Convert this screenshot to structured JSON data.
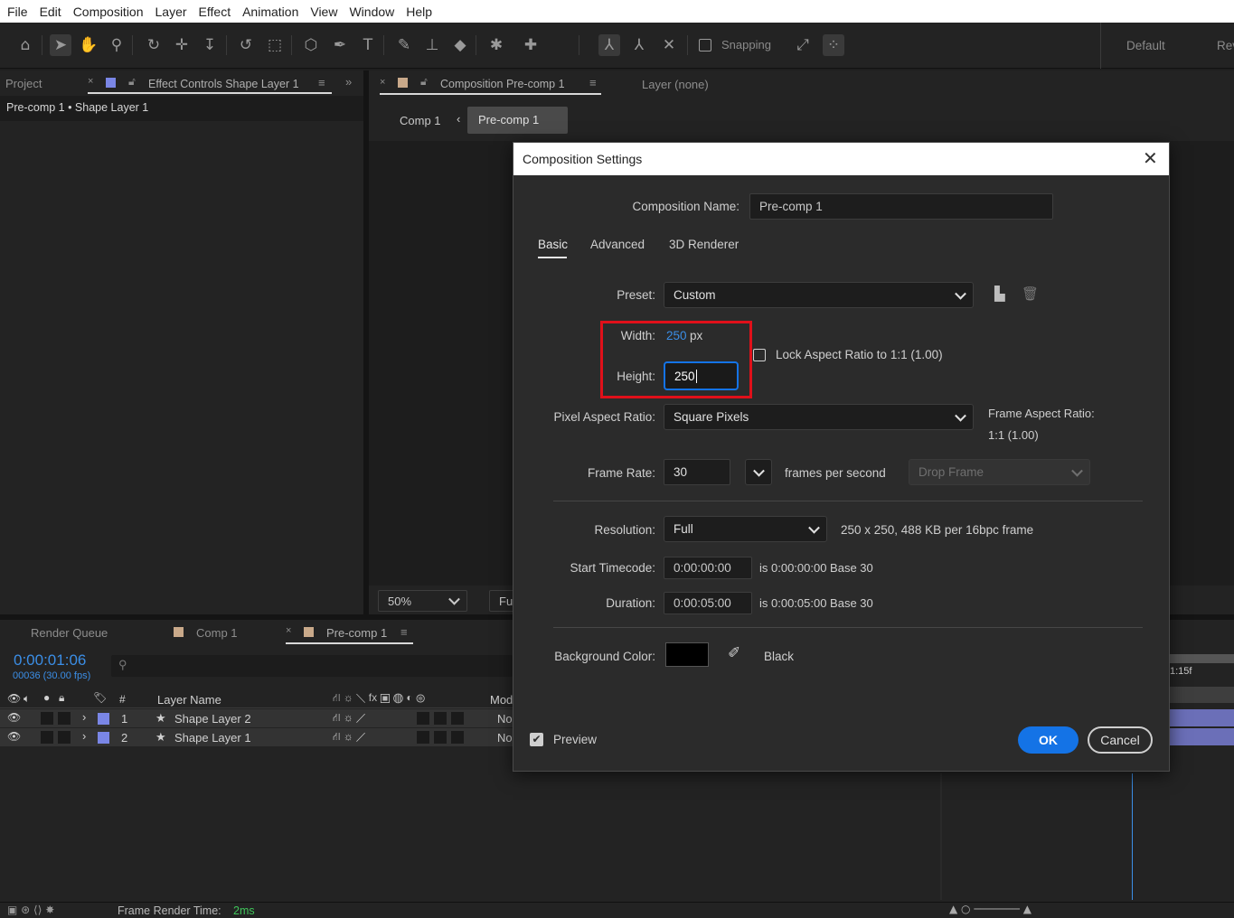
{
  "menu": [
    "File",
    "Edit",
    "Composition",
    "Layer",
    "Effect",
    "Animation",
    "View",
    "Window",
    "Help"
  ],
  "toolbar": {
    "snapping_label": "Snapping",
    "workspace_default": "Default",
    "workspace_review": "Rev"
  },
  "project_panel": {
    "tab_project": "Project",
    "tab_effect_controls": "Effect Controls Shape Layer 1",
    "breadcrumb": "Pre-comp 1 • Shape Layer 1"
  },
  "comp_panel": {
    "tab_composition": "Composition Pre-comp 1",
    "tab_layer": "Layer (none)",
    "nav_comp1": "Comp 1",
    "nav_precomp1": "Pre-comp 1",
    "zoom": "50%",
    "resolution_partial": "Fu"
  },
  "timeline": {
    "tab_render_queue": "Render Queue",
    "tab_comp1": "Comp 1",
    "tab_precomp1": "Pre-comp 1",
    "timecode": "0:00:01:06",
    "frame_info": "00036 (30.00 fps)",
    "search_placeholder": "",
    "col_number": "#",
    "col_layer_name": "Layer Name",
    "col_mode": "Mod",
    "ruler_label": "1:15f",
    "layers": [
      {
        "num": "1",
        "name": "Shape Layer 2",
        "mode": "No",
        "color": "#7a86e6"
      },
      {
        "num": "2",
        "name": "Shape Layer 1",
        "mode": "No",
        "color": "#7a86e6"
      }
    ],
    "frame_render_label": "Frame Render Time:",
    "frame_render_value": "2ms"
  },
  "dialog": {
    "title": "Composition Settings",
    "comp_name_label": "Composition Name:",
    "comp_name_value": "Pre-comp 1",
    "tabs": [
      "Basic",
      "Advanced",
      "3D Renderer"
    ],
    "preset_label": "Preset:",
    "preset_value": "Custom",
    "width_label": "Width:",
    "width_value": "250",
    "width_unit": "px",
    "height_label": "Height:",
    "height_value": "250",
    "lock_aspect_label": "Lock Aspect Ratio to 1:1 (1.00)",
    "pixel_aspect_label": "Pixel Aspect Ratio:",
    "pixel_aspect_value": "Square Pixels",
    "frame_aspect_label": "Frame Aspect Ratio:",
    "frame_aspect_value": "1:1 (1.00)",
    "frame_rate_label": "Frame Rate:",
    "frame_rate_value": "30",
    "fps_label": "frames per second",
    "drop_frame_value": "Drop Frame",
    "resolution_label": "Resolution:",
    "resolution_value": "Full",
    "resolution_info": "250 x 250, 488 KB per 16bpc frame",
    "start_tc_label": "Start Timecode:",
    "start_tc_value": "0:00:00:00",
    "start_tc_info": "is 0:00:00:00  Base 30",
    "duration_label": "Duration:",
    "duration_value": "0:00:05:00",
    "duration_info": "is 0:00:05:00  Base 30",
    "bg_color_label": "Background Color:",
    "bg_color_name": "Black",
    "bg_color_hex": "#000000",
    "preview_label": "Preview",
    "ok_label": "OK",
    "cancel_label": "Cancel"
  },
  "colors": {
    "accent_blue": "#1473e6",
    "highlight_red": "#e0101a",
    "layer_label_color": "#7a86e6"
  }
}
